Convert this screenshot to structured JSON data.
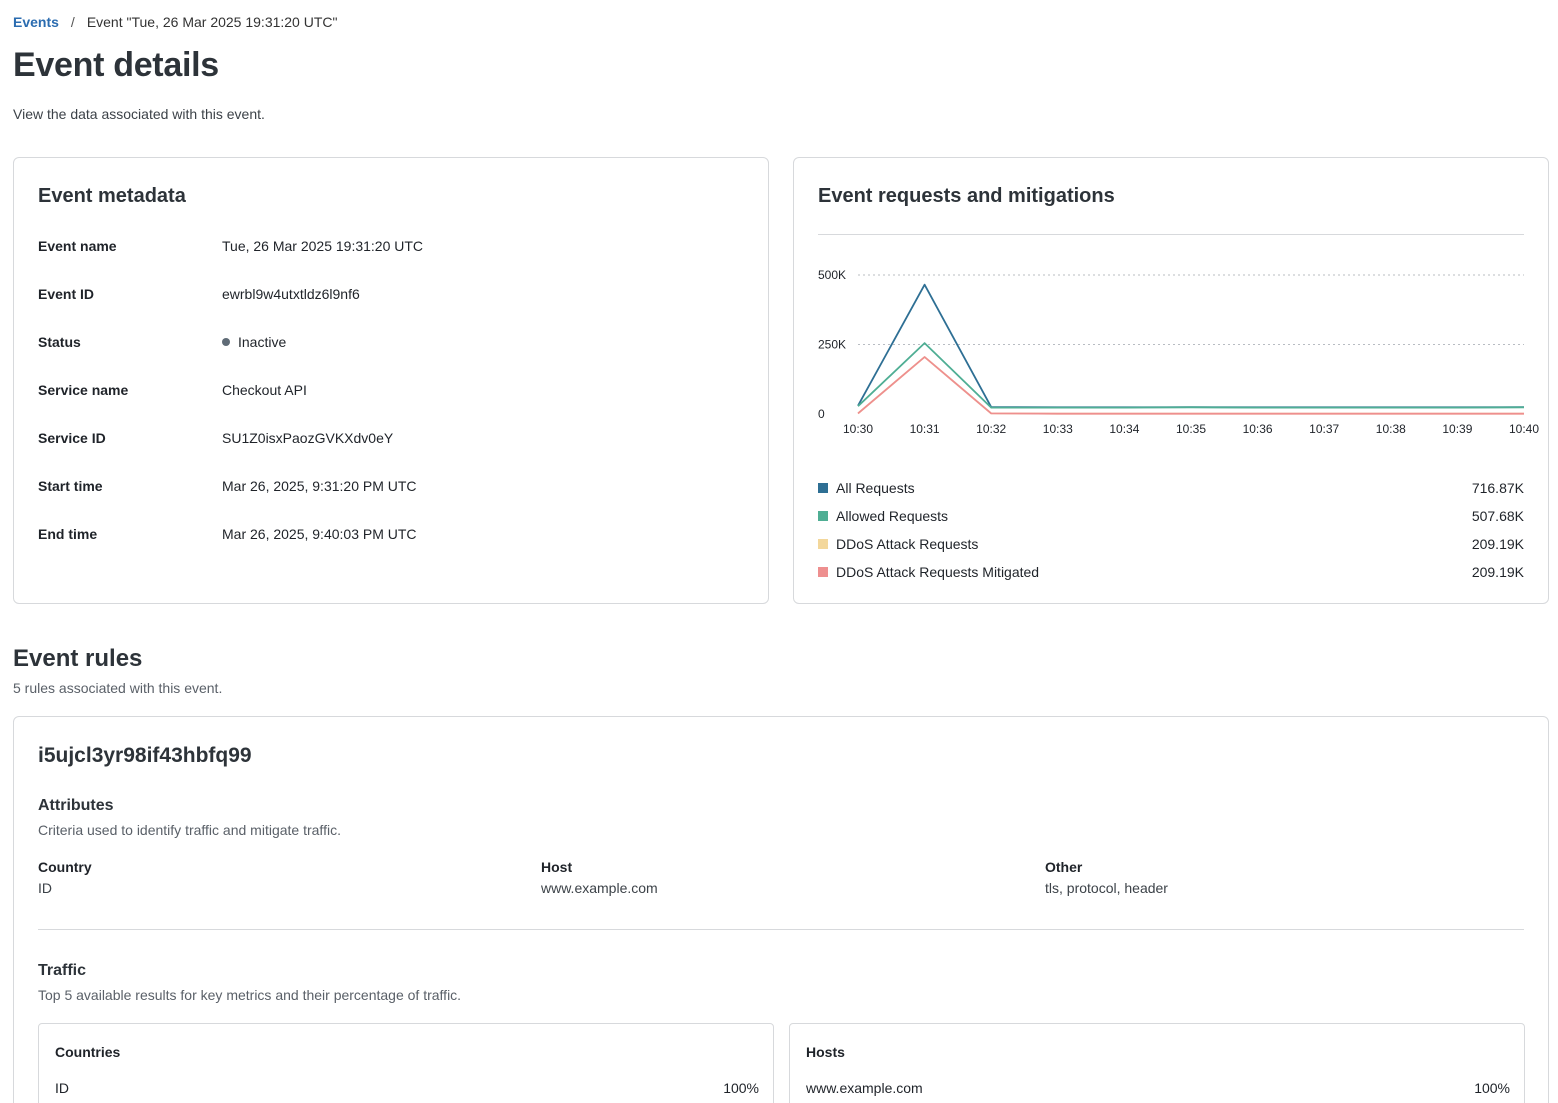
{
  "breadcrumb": {
    "parent": "Events",
    "separator": "/",
    "current": "Event \"Tue, 26 Mar 2025 19:31:20 UTC\""
  },
  "header": {
    "title": "Event details",
    "subtitle": "View the data associated with this event."
  },
  "metadata": {
    "title": "Event metadata",
    "rows": [
      {
        "label": "Event name",
        "value": "Tue, 26 Mar 2025 19:31:20 UTC"
      },
      {
        "label": "Event ID",
        "value": "ewrbl9w4utxtldz6l9nf6"
      },
      {
        "label": "Status",
        "value": "Inactive"
      },
      {
        "label": "Service name",
        "value": "Checkout API"
      },
      {
        "label": "Service ID",
        "value": "SU1Z0isxPaozGVKXdv0eY"
      },
      {
        "label": "Start time",
        "value": "Mar 26, 2025, 9:31:20 PM UTC"
      },
      {
        "label": "End time",
        "value": "Mar 26, 2025, 9:40:03 PM UTC"
      }
    ]
  },
  "chart_panel": {
    "title": "Event requests and mitigations",
    "legend": [
      {
        "name": "All Requests",
        "total": "716.87K",
        "color": "#2e6f94"
      },
      {
        "name": "Allowed Requests",
        "total": "507.68K",
        "color": "#4fae94"
      },
      {
        "name": "DDoS Attack Requests",
        "total": "209.19K",
        "color": "#f3d79b"
      },
      {
        "name": "DDoS Attack Requests Mitigated",
        "total": "209.19K",
        "color": "#ee8f8f"
      }
    ]
  },
  "chart_data": {
    "type": "line",
    "x": [
      "10:30",
      "10:31",
      "10:32",
      "10:33",
      "10:34",
      "10:35",
      "10:36",
      "10:37",
      "10:38",
      "10:39",
      "10:40"
    ],
    "ylim": [
      0,
      500000
    ],
    "yticks": [
      0,
      250000,
      500000
    ],
    "ytick_labels": [
      "0",
      "250K",
      "500K"
    ],
    "grid": true,
    "series": [
      {
        "name": "All Requests",
        "color": "#2e6f94",
        "values": [
          30000,
          465000,
          25000,
          24000,
          24000,
          25000,
          24000,
          24000,
          24000,
          24000,
          25000
        ]
      },
      {
        "name": "Allowed Requests",
        "color": "#4fae94",
        "values": [
          28000,
          255000,
          23000,
          23000,
          23000,
          24000,
          23000,
          23000,
          23000,
          23000,
          24000
        ]
      },
      {
        "name": "DDoS Attack Requests",
        "color": "#f3d79b",
        "values": [
          2000,
          205000,
          2000,
          1000,
          1000,
          1000,
          1000,
          1000,
          1000,
          1000,
          1000
        ]
      },
      {
        "name": "DDoS Attack Requests Mitigated",
        "color": "#ee8f8f",
        "values": [
          2000,
          205000,
          2000,
          1000,
          1000,
          1000,
          1000,
          1000,
          1000,
          1000,
          1000
        ]
      }
    ]
  },
  "rules_section": {
    "title": "Event rules",
    "subtitle": "5 rules associated with this event."
  },
  "rule": {
    "id": "i5ujcl3yr98if43hbfq99",
    "attributes_title": "Attributes",
    "attributes_desc": "Criteria used to identify traffic and mitigate traffic.",
    "attributes": [
      {
        "label": "Country",
        "value": "ID"
      },
      {
        "label": "Host",
        "value": "www.example.com"
      },
      {
        "label": "Other",
        "value": "tls, protocol, header"
      }
    ],
    "traffic_title": "Traffic",
    "traffic_desc": "Top 5 available results for key metrics and their percentage of traffic.",
    "countries": {
      "title": "Countries",
      "rows": [
        {
          "name": "ID",
          "pct": "100%"
        }
      ]
    },
    "hosts": {
      "title": "Hosts",
      "rows": [
        {
          "name": "www.example.com",
          "pct": "100%"
        }
      ]
    }
  }
}
